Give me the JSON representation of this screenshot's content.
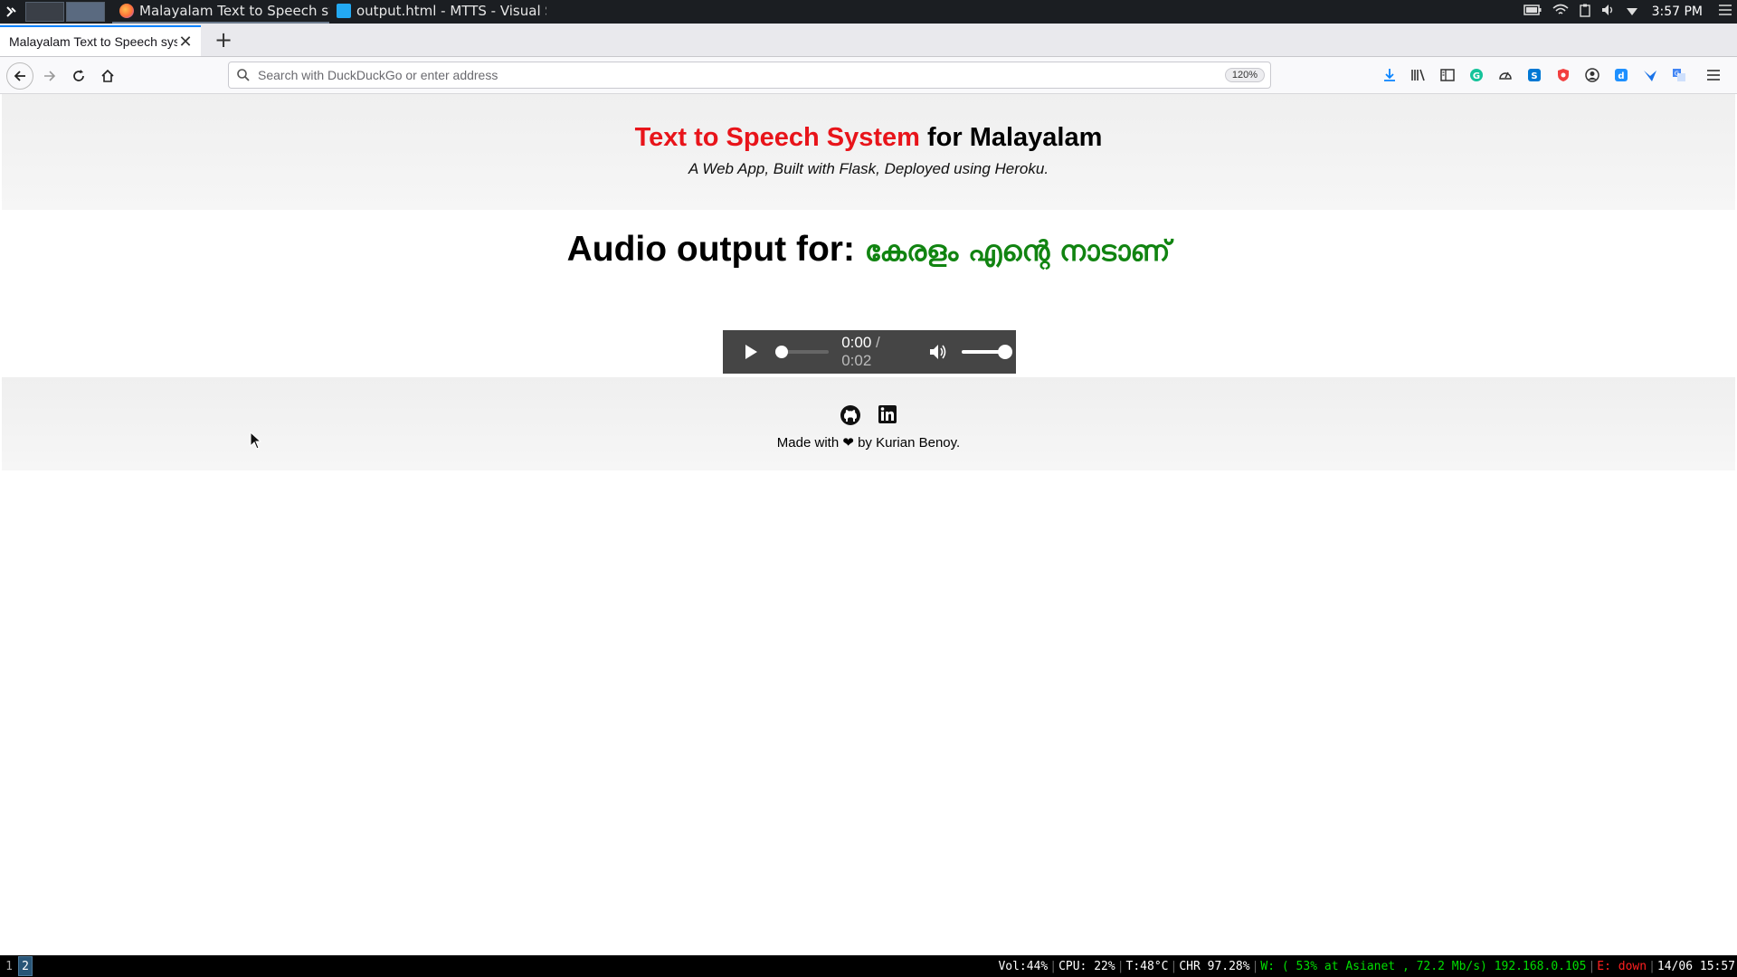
{
  "taskbar": {
    "tasks": [
      {
        "title": "Malayalam Text to Speech system..."
      },
      {
        "title": "output.html - MTTS - Visual Studi..."
      }
    ],
    "clock": "3:57 PM"
  },
  "browser": {
    "tab_title": "Malayalam Text to Speech syst",
    "url_placeholder": "Search with DuckDuckGo or enter address",
    "zoom": "120%"
  },
  "page": {
    "title_red": "Text to Speech System",
    "title_rest": " for Malayalam",
    "subtitle": "A Web App, Built with Flask, Deployed using Heroku.",
    "output_label": "Audio output for:",
    "output_text": "കേരളം എന്റെ നാടാണ്",
    "player": {
      "current": "0:00",
      "separator": " / ",
      "duration": "0:02",
      "volume_level": 1.0,
      "progress": 0.0
    },
    "footer_text": "Made with ❤ by Kurian Benoy."
  },
  "statusbar": {
    "workspaces": [
      "1",
      "2"
    ],
    "vol": "Vol:44%",
    "cpu": "CPU: 22%",
    "temp": "T:48°C",
    "chr": "CHR 97.28%",
    "wifi": "W: ( 53% at Asianet , 72.2 Mb/s) 192.168.0.105",
    "eth": "E: down",
    "datetime": "14/06 15:57"
  },
  "colors": {
    "accent_red": "#e8141a",
    "malayalam_green": "#118411",
    "player_bg": "#454545"
  }
}
